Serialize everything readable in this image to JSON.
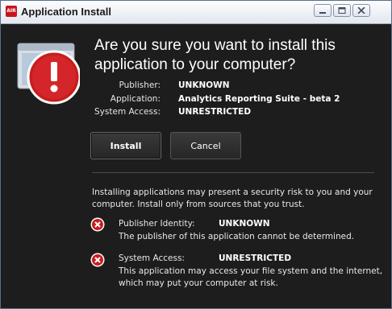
{
  "window": {
    "title": "Application Install",
    "app_icon_text": "AIR",
    "buttons": [
      "minimize",
      "maximize",
      "close"
    ]
  },
  "dialog": {
    "heading": "Are you sure you want to install this application to your computer?",
    "details": [
      {
        "label": "Publisher:",
        "value": "UNKNOWN"
      },
      {
        "label": "Application:",
        "value": "Analytics Reporting Suite - beta 2"
      },
      {
        "label": "System Access:",
        "value": "UNRESTRICTED"
      }
    ],
    "install_label": "Install",
    "cancel_label": "Cancel",
    "warning": "Installing applications may present a security risk to you and your computer. Install only from sources that you trust.",
    "risks": [
      {
        "label": "Publisher Identity:",
        "value": "UNKNOWN",
        "description": "The publisher of this application cannot be determined."
      },
      {
        "label": "System Access:",
        "value": "UNRESTRICTED",
        "description": "This application may access your file system and the internet, which may put your computer at risk."
      }
    ]
  },
  "colors": {
    "background": "#1d1d1d",
    "warning_red": "#c81e1e",
    "titlebar": "#e3e8ef"
  },
  "icons": {
    "app": "monitor-with-warning-icon",
    "risk": "red-x-circle-icon"
  }
}
